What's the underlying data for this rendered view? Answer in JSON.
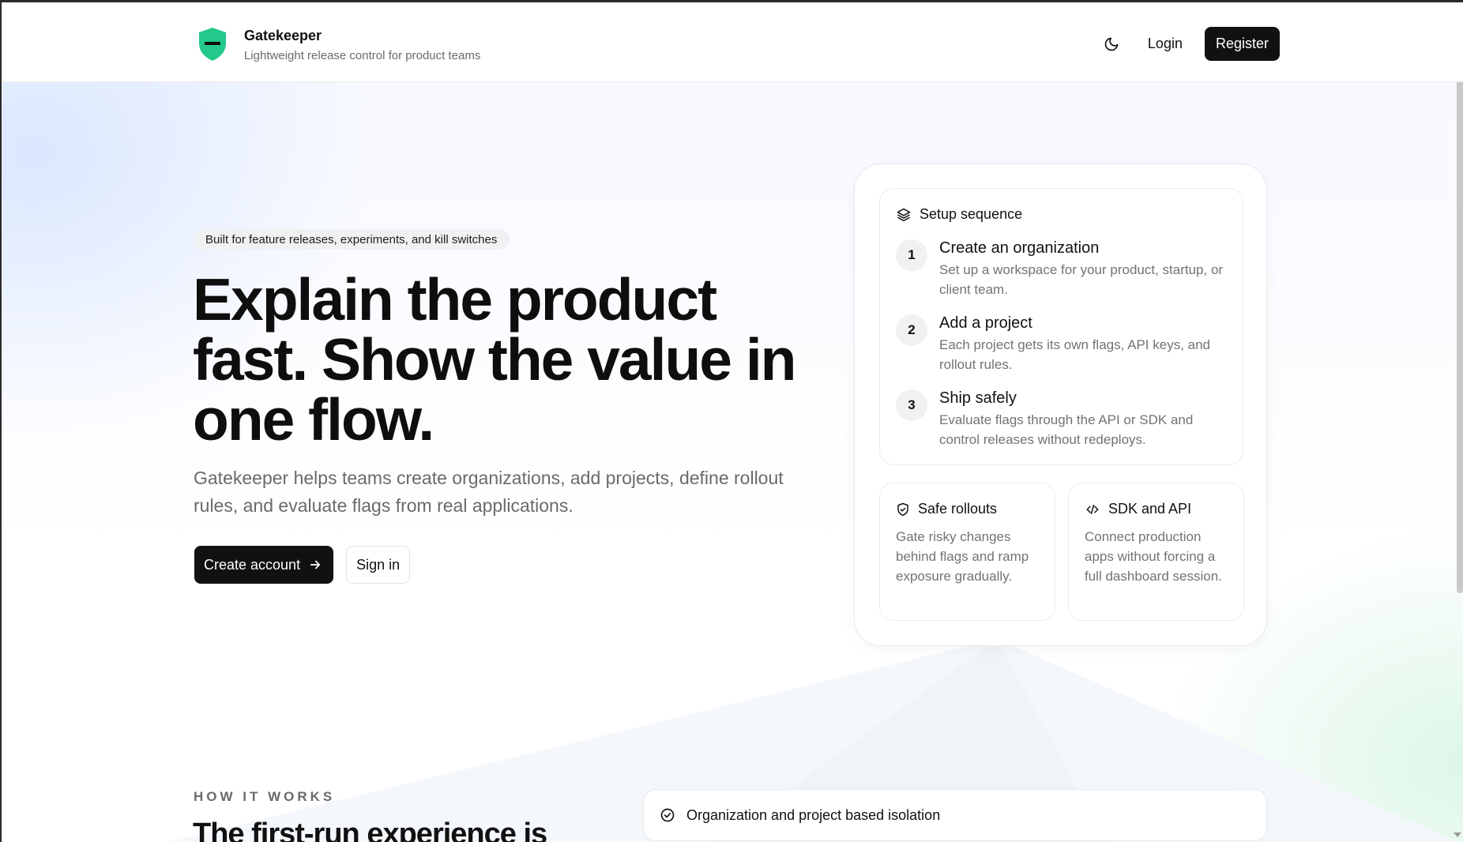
{
  "header": {
    "brand_name": "Gatekeeper",
    "brand_tagline": "Lightweight release control for product teams",
    "login_label": "Login",
    "register_label": "Register"
  },
  "hero": {
    "pill": "Built for feature releases, experiments, and kill switches",
    "title": "Explain the product fast. Show the value in one flow.",
    "description": "Gatekeeper helps teams create organizations, add projects, define rollout rules, and evaluate flags from real applications.",
    "primary_cta": "Create account",
    "secondary_cta": "Sign in"
  },
  "setup": {
    "heading": "Setup sequence",
    "steps": [
      {
        "num": "1",
        "title": "Create an organization",
        "text": "Set up a workspace for your product, startup, or client team."
      },
      {
        "num": "2",
        "title": "Add a project",
        "text": "Each project gets its own flags, API keys, and rollout rules."
      },
      {
        "num": "3",
        "title": "Ship safely",
        "text": "Evaluate flags through the API or SDK and control releases without redeploys."
      }
    ]
  },
  "features": [
    {
      "title": "Safe rollouts",
      "text": "Gate risky changes behind flags and ramp exposure gradually.",
      "icon": "shield-check-icon"
    },
    {
      "title": "SDK and API",
      "text": "Connect production apps without forcing a full dashboard session.",
      "icon": "code-icon"
    }
  ],
  "how": {
    "label": "HOW IT WORKS",
    "title": "The first-run experience is",
    "isolation": "Organization and project based isolation"
  },
  "colors": {
    "brand_green": "#22c98a",
    "primary_button": "#111111"
  }
}
